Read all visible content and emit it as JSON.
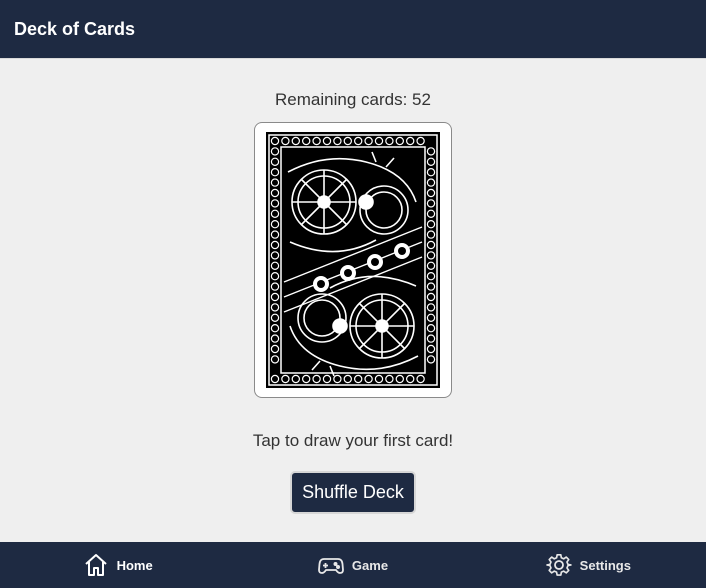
{
  "header": {
    "title": "Deck of Cards"
  },
  "main": {
    "remaining_label": "Remaining cards: 52",
    "prompt": "Tap to draw your first card!",
    "shuffle_label": "Shuffle Deck"
  },
  "nav": {
    "items": [
      {
        "label": "Home",
        "icon": "home-icon",
        "active": true
      },
      {
        "label": "Game",
        "icon": "gamepad-icon",
        "active": false
      },
      {
        "label": "Settings",
        "icon": "gear-icon",
        "active": false
      }
    ]
  },
  "colors": {
    "bar_background": "#1e2a42",
    "page_background": "#efefef",
    "text": "#333333",
    "card_back": "#000000"
  }
}
